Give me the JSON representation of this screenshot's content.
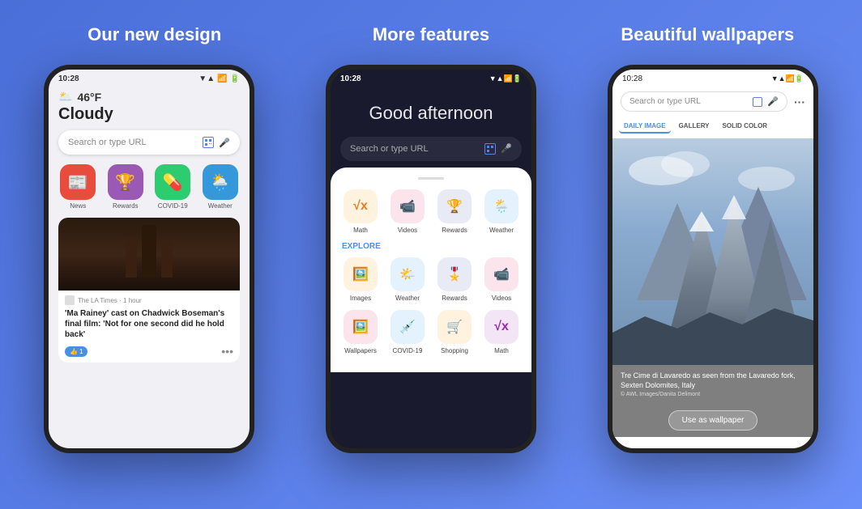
{
  "headlines": {
    "left": "Our new design",
    "middle": "More features",
    "right": "Beautiful wallpapers"
  },
  "phone_left": {
    "status_time": "10:28",
    "weather_temp": "46°F",
    "weather_condition": "Cloudy",
    "search_placeholder": "Search or type URL",
    "app_icons": [
      {
        "label": "News",
        "color": "#e74c3c",
        "emoji": "📰"
      },
      {
        "label": "Rewards",
        "color": "#9b59b6",
        "emoji": "🏆"
      },
      {
        "label": "COVID-19",
        "color": "#2ecc71",
        "emoji": "💊"
      },
      {
        "label": "Weather",
        "color": "#3498db",
        "emoji": "☁️"
      }
    ],
    "news_source": "The LA Times · 1 hour",
    "news_title": "'Ma Rainey' cast on Chadwick Boseman's final film: 'Not for one second did he hold back'"
  },
  "phone_middle": {
    "status_time": "10:28",
    "greeting": "Good afternoon",
    "search_placeholder": "Search or type URL",
    "features": [
      {
        "label": "Math",
        "emoji": "✖️"
      },
      {
        "label": "Videos",
        "emoji": "📹"
      },
      {
        "label": "Rewards",
        "emoji": "🏆"
      },
      {
        "label": "Weather",
        "emoji": "🌦️"
      }
    ],
    "explore_label": "EXPLORE",
    "explore_items": [
      {
        "label": "Images",
        "emoji": "🖼️"
      },
      {
        "label": "Weather",
        "emoji": "🌤️"
      },
      {
        "label": "Rewards",
        "emoji": "🎖️"
      },
      {
        "label": "Videos",
        "emoji": "📹"
      },
      {
        "label": "Wallpapers",
        "emoji": "🖼️"
      },
      {
        "label": "COVID-19",
        "emoji": "💉"
      },
      {
        "label": "Shopping",
        "emoji": "🛒"
      },
      {
        "label": "Math",
        "emoji": "✖️"
      }
    ]
  },
  "phone_right": {
    "status_time": "10:28",
    "search_placeholder": "Search or type URL",
    "tabs": [
      {
        "label": "DAILY IMAGE",
        "active": true
      },
      {
        "label": "GALLERY",
        "active": false
      },
      {
        "label": "SOLID COLOR",
        "active": false
      }
    ],
    "caption": "Tre Cime di Lavaredo as seen from the Lavaredo fork, Sexten Dolomites, Italy",
    "credit": "© AWL Images/Danita Delimont",
    "use_wallpaper_btn": "Use as wallpaper"
  }
}
